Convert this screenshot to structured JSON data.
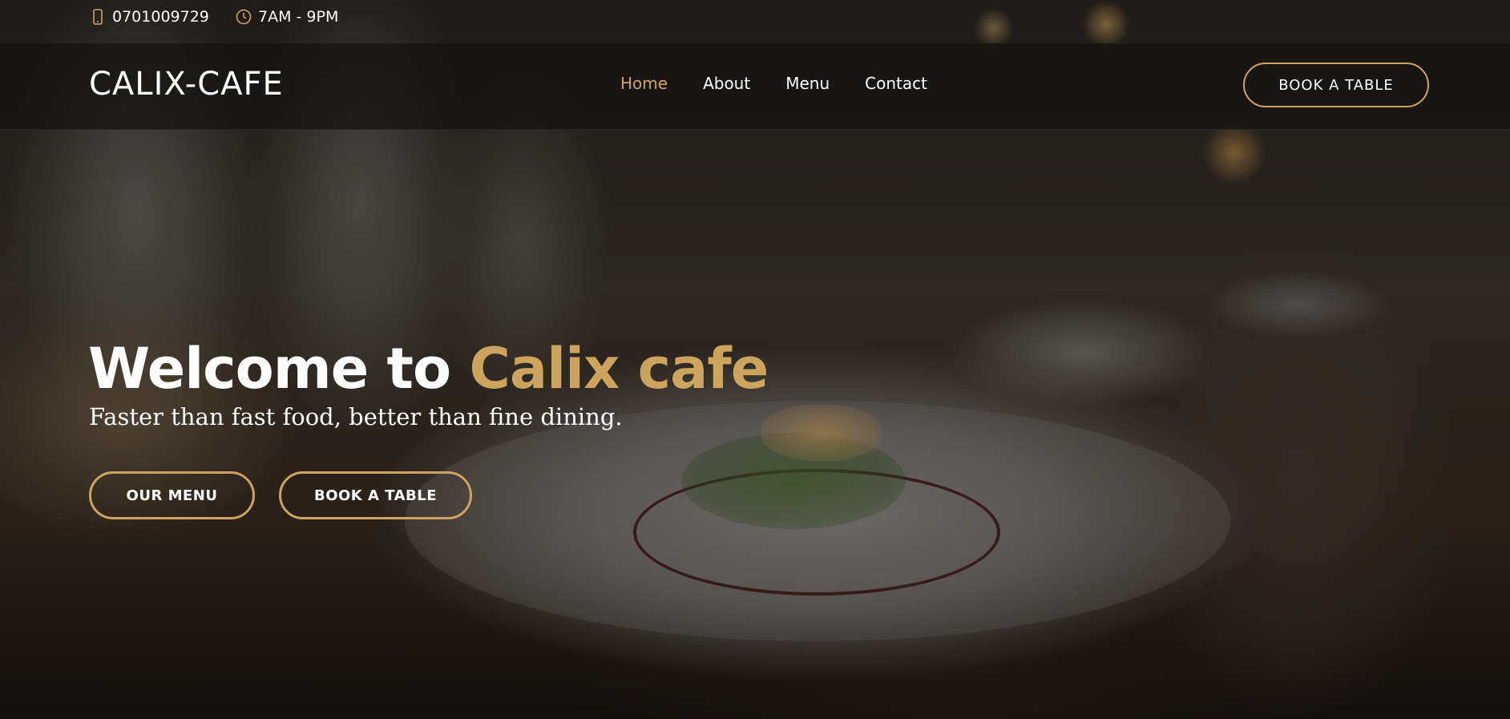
{
  "topbar": {
    "phone": "0701009729",
    "hours": "7AM - 9PM",
    "phone_icon": "smartphone-icon",
    "hours_icon": "clock-icon"
  },
  "header": {
    "logo": "CALIX-CAFE",
    "nav": [
      {
        "label": "Home",
        "active": true
      },
      {
        "label": "About",
        "active": false
      },
      {
        "label": "Menu",
        "active": false
      },
      {
        "label": "Contact",
        "active": false
      }
    ],
    "book_button": "BOOK A TABLE"
  },
  "hero": {
    "title_prefix": "Welcome to ",
    "title_accent": "Calix cafe",
    "subtitle": "Faster than fast food, better than fine dining.",
    "menu_button": "OUR MENU",
    "book_button": "BOOK A TABLE",
    "background": "restaurant-table-plate-photo"
  },
  "colors": {
    "accent": "#cda45e",
    "text": "#ffffff",
    "header_bg": "#161412"
  }
}
